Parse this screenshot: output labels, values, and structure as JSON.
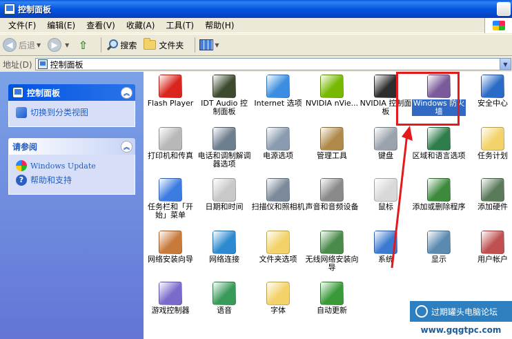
{
  "window": {
    "title": "控制面板"
  },
  "menu": [
    "文件(F)",
    "编辑(E)",
    "查看(V)",
    "收藏(A)",
    "工具(T)",
    "帮助(H)"
  ],
  "toolbar": {
    "back": "后退",
    "search": "搜索",
    "folders": "文件夹"
  },
  "address": {
    "label": "地址(D)",
    "value": "控制面板"
  },
  "sidebar": {
    "panel1": {
      "title": "控制面板",
      "link": "切换到分类视图"
    },
    "panel2": {
      "title": "请参阅",
      "links": [
        "Windows Update",
        "帮助和支持"
      ]
    }
  },
  "icons": [
    {
      "label": "Flash Player",
      "color": "#d9251c",
      "icon": "flash-icon"
    },
    {
      "label": "IDT Audio 控制面板",
      "color": "#3d4a2e",
      "icon": "audio-icon"
    },
    {
      "label": "Internet 选项",
      "color": "#3a8de0",
      "icon": "internet-options-icon"
    },
    {
      "label": "NVIDIA nVie...",
      "color": "#76b900",
      "icon": "nvidia-icon"
    },
    {
      "label": "NVIDIA 控制面板",
      "color": "#2d2d2d",
      "icon": "nvidia-panel-icon"
    },
    {
      "label": "Windows 防火墙",
      "color": "#7a5a9a",
      "icon": "firewall-icon",
      "selected": true
    },
    {
      "label": "安全中心",
      "color": "#2a6bc8",
      "icon": "security-center-icon"
    },
    {
      "label": "打印机和传真",
      "color": "#b8b8b8",
      "icon": "printer-icon"
    },
    {
      "label": "电话和调制解调器选项",
      "color": "#6d7e8e",
      "icon": "phone-icon"
    },
    {
      "label": "电源选项",
      "color": "#8a9bb0",
      "icon": "power-icon"
    },
    {
      "label": "管理工具",
      "color": "#b08a4a",
      "icon": "admin-tools-icon"
    },
    {
      "label": "键盘",
      "color": "#9aa3ab",
      "icon": "keyboard-icon"
    },
    {
      "label": "区域和语言选项",
      "color": "#2e7d4a",
      "icon": "region-icon"
    },
    {
      "label": "任务计划",
      "color": "#f3d26a",
      "icon": "task-scheduler-icon"
    },
    {
      "label": "任务栏和「开始」菜单",
      "color": "#3c7be0",
      "icon": "taskbar-icon"
    },
    {
      "label": "日期和时间",
      "color": "#c8c8c8",
      "icon": "clock-icon"
    },
    {
      "label": "扫描仪和照相机",
      "color": "#7a8a9a",
      "icon": "scanner-icon"
    },
    {
      "label": "声音和音频设备",
      "color": "#8a8a8a",
      "icon": "speaker-icon"
    },
    {
      "label": "鼠标",
      "color": "#d8d8d8",
      "icon": "mouse-icon"
    },
    {
      "label": "添加或删除程序",
      "color": "#3d8a3d",
      "icon": "add-remove-icon"
    },
    {
      "label": "添加硬件",
      "color": "#5a7a5a",
      "icon": "add-hardware-icon"
    },
    {
      "label": "网络安装向导",
      "color": "#c87a3a",
      "icon": "network-wizard-icon"
    },
    {
      "label": "网络连接",
      "color": "#2e8ad0",
      "icon": "network-icon"
    },
    {
      "label": "文件夹选项",
      "color": "#f3d26a",
      "icon": "folder-options-icon"
    },
    {
      "label": "无线网络安装向导",
      "color": "#4a8a4a",
      "icon": "wireless-icon"
    },
    {
      "label": "系统",
      "color": "#3a7ad0",
      "icon": "system-icon"
    },
    {
      "label": "显示",
      "color": "#5a8ab0",
      "icon": "display-icon"
    },
    {
      "label": "用户帐户",
      "color": "#c05050",
      "icon": "user-accounts-icon"
    },
    {
      "label": "游戏控制器",
      "color": "#7a6acb",
      "icon": "game-controller-icon"
    },
    {
      "label": "语音",
      "color": "#3a9a5a",
      "icon": "speech-icon"
    },
    {
      "label": "字体",
      "color": "#f3d26a",
      "icon": "fonts-icon"
    },
    {
      "label": "自动更新",
      "color": "#3a9a3a",
      "icon": "auto-update-icon"
    }
  ],
  "watermark": {
    "name": "过期罐头电脑论坛",
    "url": "www.gqgtpc.com"
  }
}
